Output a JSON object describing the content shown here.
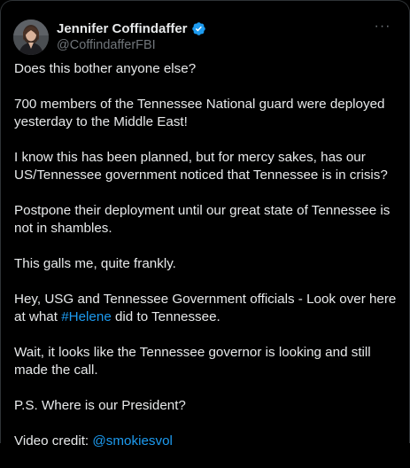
{
  "colors": {
    "background": "#000000",
    "text": "#e7e9ea",
    "muted": "#71767b",
    "link": "#1d9bf0",
    "verified": "#1d9bf0",
    "border": "#2f3336"
  },
  "author": {
    "display_name": "Jennifer Coffindaffer",
    "handle": "@CoffindafferFBI",
    "verified_icon": "verified-badge-icon",
    "avatar_icon": "avatar"
  },
  "more_icon": "more-options-icon",
  "more_glyph": "···",
  "tweet": {
    "p1": "Does this bother anyone else?",
    "p2": "700 members of the Tennessee National guard were deployed yesterday to the Middle East!",
    "p3": "I know this has been planned, but for mercy sakes, has our US/Tennessee government noticed that Tennessee is in crisis?",
    "p4": "Postpone their deployment until our great state of Tennessee is not in shambles.",
    "p5": "This galls me, quite frankly.",
    "p6_before": "Hey, USG and Tennessee Government officials - Look over here at what ",
    "p6_hashtag": "#Helene",
    "p6_after": " did to Tennessee.",
    "p7": "Wait, it looks like the Tennessee governor is looking and still made the call.",
    "p8": "P.S. Where is our President?",
    "p9_label": "Video credit: ",
    "p9_mention": "@smokiesvol"
  }
}
